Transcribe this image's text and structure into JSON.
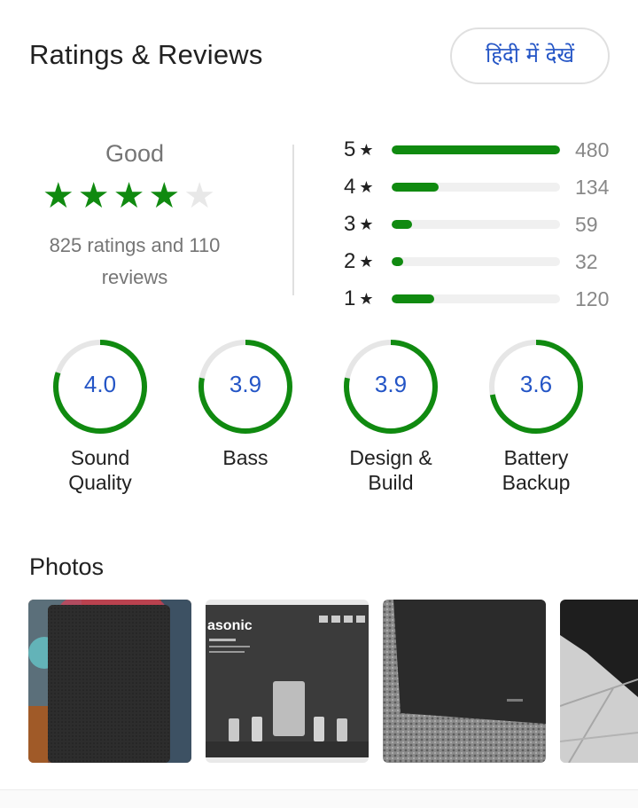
{
  "header": {
    "title": "Ratings & Reviews",
    "lang_button": "हिंदी में देखें"
  },
  "summary": {
    "verdict": "Good",
    "stars_filled": 4,
    "stars_total": 5,
    "count_text": "825 ratings and 110 reviews",
    "star_on_color": "#108a10",
    "star_off_color": "#e8e8e8"
  },
  "distribution": [
    {
      "stars": "5",
      "count": "480",
      "fraction": 1.0
    },
    {
      "stars": "4",
      "count": "134",
      "fraction": 0.28
    },
    {
      "stars": "3",
      "count": "59",
      "fraction": 0.12
    },
    {
      "stars": "2",
      "count": "32",
      "fraction": 0.07
    },
    {
      "stars": "1",
      "count": "120",
      "fraction": 0.25
    }
  ],
  "aspects": [
    {
      "value": "4.0",
      "label": "Sound\nQuality",
      "score_fraction": 0.8
    },
    {
      "value": "3.9",
      "label": "Bass",
      "score_fraction": 0.78
    },
    {
      "value": "3.9",
      "label": "Design &\nBuild",
      "score_fraction": 0.78
    },
    {
      "value": "3.6",
      "label": "Battery\nBackup",
      "score_fraction": 0.72
    }
  ],
  "photos": {
    "title": "Photos",
    "items": [
      {
        "name": "speaker-photo-1",
        "overlay_text": ""
      },
      {
        "name": "speaker-box-photo",
        "overlay_text": "asonic"
      },
      {
        "name": "subwoofer-photo",
        "overlay_text": ""
      },
      {
        "name": "speaker-floor-photo",
        "overlay_text": ""
      }
    ]
  },
  "colors": {
    "accent_green": "#108a10",
    "link_blue": "#2455c6",
    "muted_text": "#757575"
  }
}
